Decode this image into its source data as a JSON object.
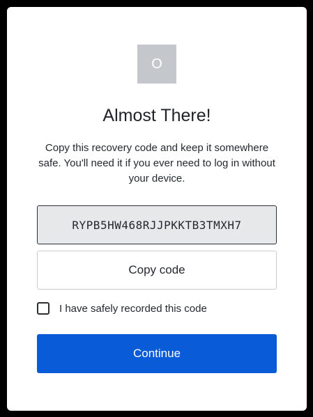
{
  "logo": {
    "glyph": "O",
    "icon": "circle-logo-icon",
    "color": "#c4c8cc"
  },
  "title": "Almost There!",
  "description": "Copy this recovery code and keep it somewhere safe. You'll need it if you ever need to log in without your device.",
  "recovery_code": "RYPB5HW468RJJPKKTB3TMXH7",
  "copy_button_label": "Copy code",
  "checkbox": {
    "label": "I have safely recorded this code",
    "checked": false
  },
  "continue_button_label": "Continue",
  "colors": {
    "accent": "#0a5bd8",
    "code_background": "#e7e8e9"
  }
}
